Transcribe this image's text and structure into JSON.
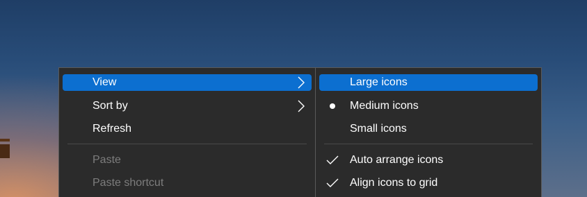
{
  "context_menu": {
    "items": [
      {
        "label": "View",
        "has_submenu": true,
        "highlighted": true,
        "enabled": true
      },
      {
        "label": "Sort by",
        "has_submenu": true,
        "highlighted": false,
        "enabled": true
      },
      {
        "label": "Refresh",
        "has_submenu": false,
        "highlighted": false,
        "enabled": true
      },
      {
        "label": "Paste",
        "has_submenu": false,
        "highlighted": false,
        "enabled": false
      },
      {
        "label": "Paste shortcut",
        "has_submenu": false,
        "highlighted": false,
        "enabled": false
      }
    ]
  },
  "view_submenu": {
    "items": [
      {
        "label": "Large icons",
        "highlighted": true,
        "marker": "none"
      },
      {
        "label": "Medium icons",
        "highlighted": false,
        "marker": "radio-dot"
      },
      {
        "label": "Small icons",
        "highlighted": false,
        "marker": "none"
      },
      {
        "label": "Auto arrange icons",
        "highlighted": false,
        "marker": "checkmark"
      },
      {
        "label": "Align icons to grid",
        "highlighted": false,
        "marker": "checkmark"
      }
    ]
  },
  "colors": {
    "menu_background": "#2b2b2b",
    "highlight": "#0c6fd0",
    "text": "#ffffff",
    "disabled_text": "#7d7d7d",
    "separator": "#4a4a4a"
  },
  "icons": {
    "submenu_arrow": "chevron-right-icon",
    "selected_marker": "radio-dot-icon",
    "check_marker": "checkmark-icon"
  }
}
